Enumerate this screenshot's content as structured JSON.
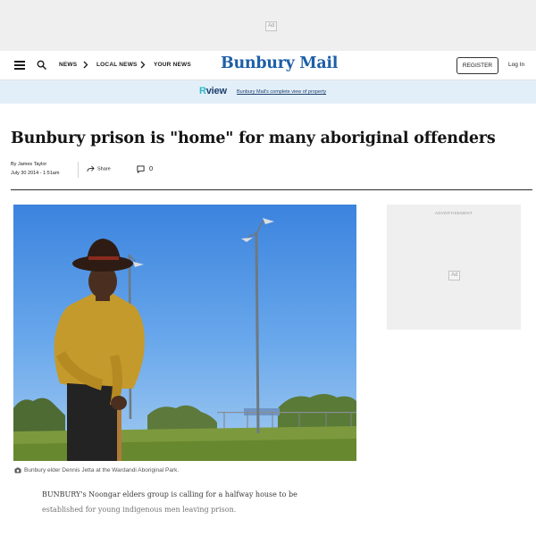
{
  "ads": {
    "top_badge": "Ad",
    "side_label": "ADVERTISEMENT",
    "side_badge": "Ad"
  },
  "nav": {
    "links": [
      "NEWS",
      "LOCAL NEWS",
      "YOUR NEWS"
    ],
    "logo": "Bunbury Mail",
    "register": "REGISTER",
    "login": "Log In"
  },
  "view_banner": {
    "logo_r": "R",
    "logo_text": "view",
    "link": "Bunbury Mail's complete view of property"
  },
  "article": {
    "headline": "Bunbury prison is \"home\" for many aboriginal offenders",
    "byline": "By James Taylor",
    "date": "July 30 2014 - 1:51am",
    "share_label": "Share",
    "comment_count": "0",
    "caption": "Bunbury elder Dennis Jetta at the Wardandi Aboriginal Park.",
    "body": "BUNBURY's Noongar elders group is calling for a halfway house to be established for young indigenous men leaving prison."
  },
  "colors": {
    "brand_blue": "#1e5fa8",
    "banner_bg": "#e3eff8",
    "view_accent": "#2eb8c8"
  }
}
